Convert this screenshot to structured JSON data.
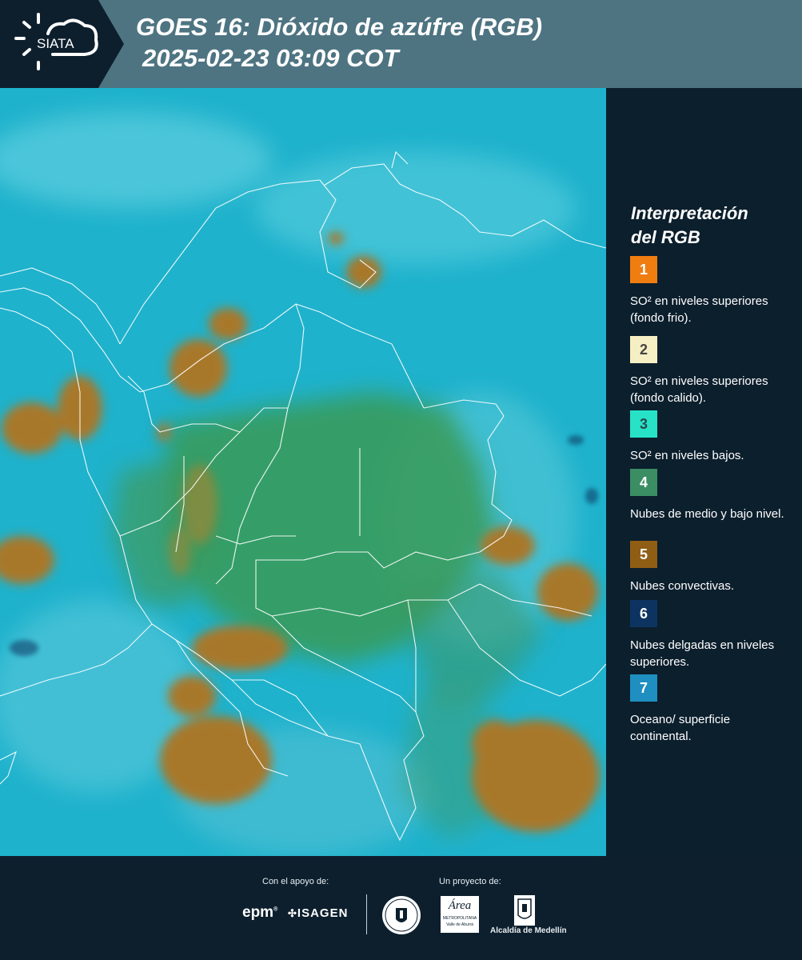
{
  "header": {
    "logo_text": "SIATA",
    "title_line1": "GOES 16: Dióxido de azúfre (RGB)",
    "title_line2": "2025-02-23 03:09 COT"
  },
  "map": {
    "background_color": "#1fb2cc",
    "land_color": "#3a9a55",
    "convective_color": "#a8782a",
    "border_color": "#ffffff"
  },
  "legend": {
    "title_line1": "Interpretación",
    "title_line2": "del RGB",
    "items": [
      {
        "number": "1",
        "color": "#f07d10",
        "text": "SO² en niveles superiores (fondo frio)."
      },
      {
        "number": "2",
        "color": "#f7efc4",
        "text": "SO² en niveles superiores (fondo calido)."
      },
      {
        "number": "3",
        "color": "#27e2c7",
        "text": "SO² en niveles bajos."
      },
      {
        "number": "4",
        "color": "#3b8d64",
        "text": "Nubes de medio y bajo nivel."
      },
      {
        "number": "5",
        "color": "#8f5d14",
        "text": "Nubes convectivas."
      },
      {
        "number": "6",
        "color": "#0d3460",
        "text": "Nubes delgadas en niveles superiores."
      },
      {
        "number": "7",
        "color": "#1e8fc0",
        "text": "Oceano/ superficie continental."
      }
    ]
  },
  "footer": {
    "support_label": "Con el apoyo de:",
    "project_label": "Un proyecto de:",
    "sponsor1": "epm",
    "sponsor2": "ISAGEN",
    "partner1_top": "Área",
    "partner1_sub": "METROPOLITANA",
    "partner1_sub2": "Valle de Aburrá",
    "partner2": "Alcaldía de Medellín"
  }
}
